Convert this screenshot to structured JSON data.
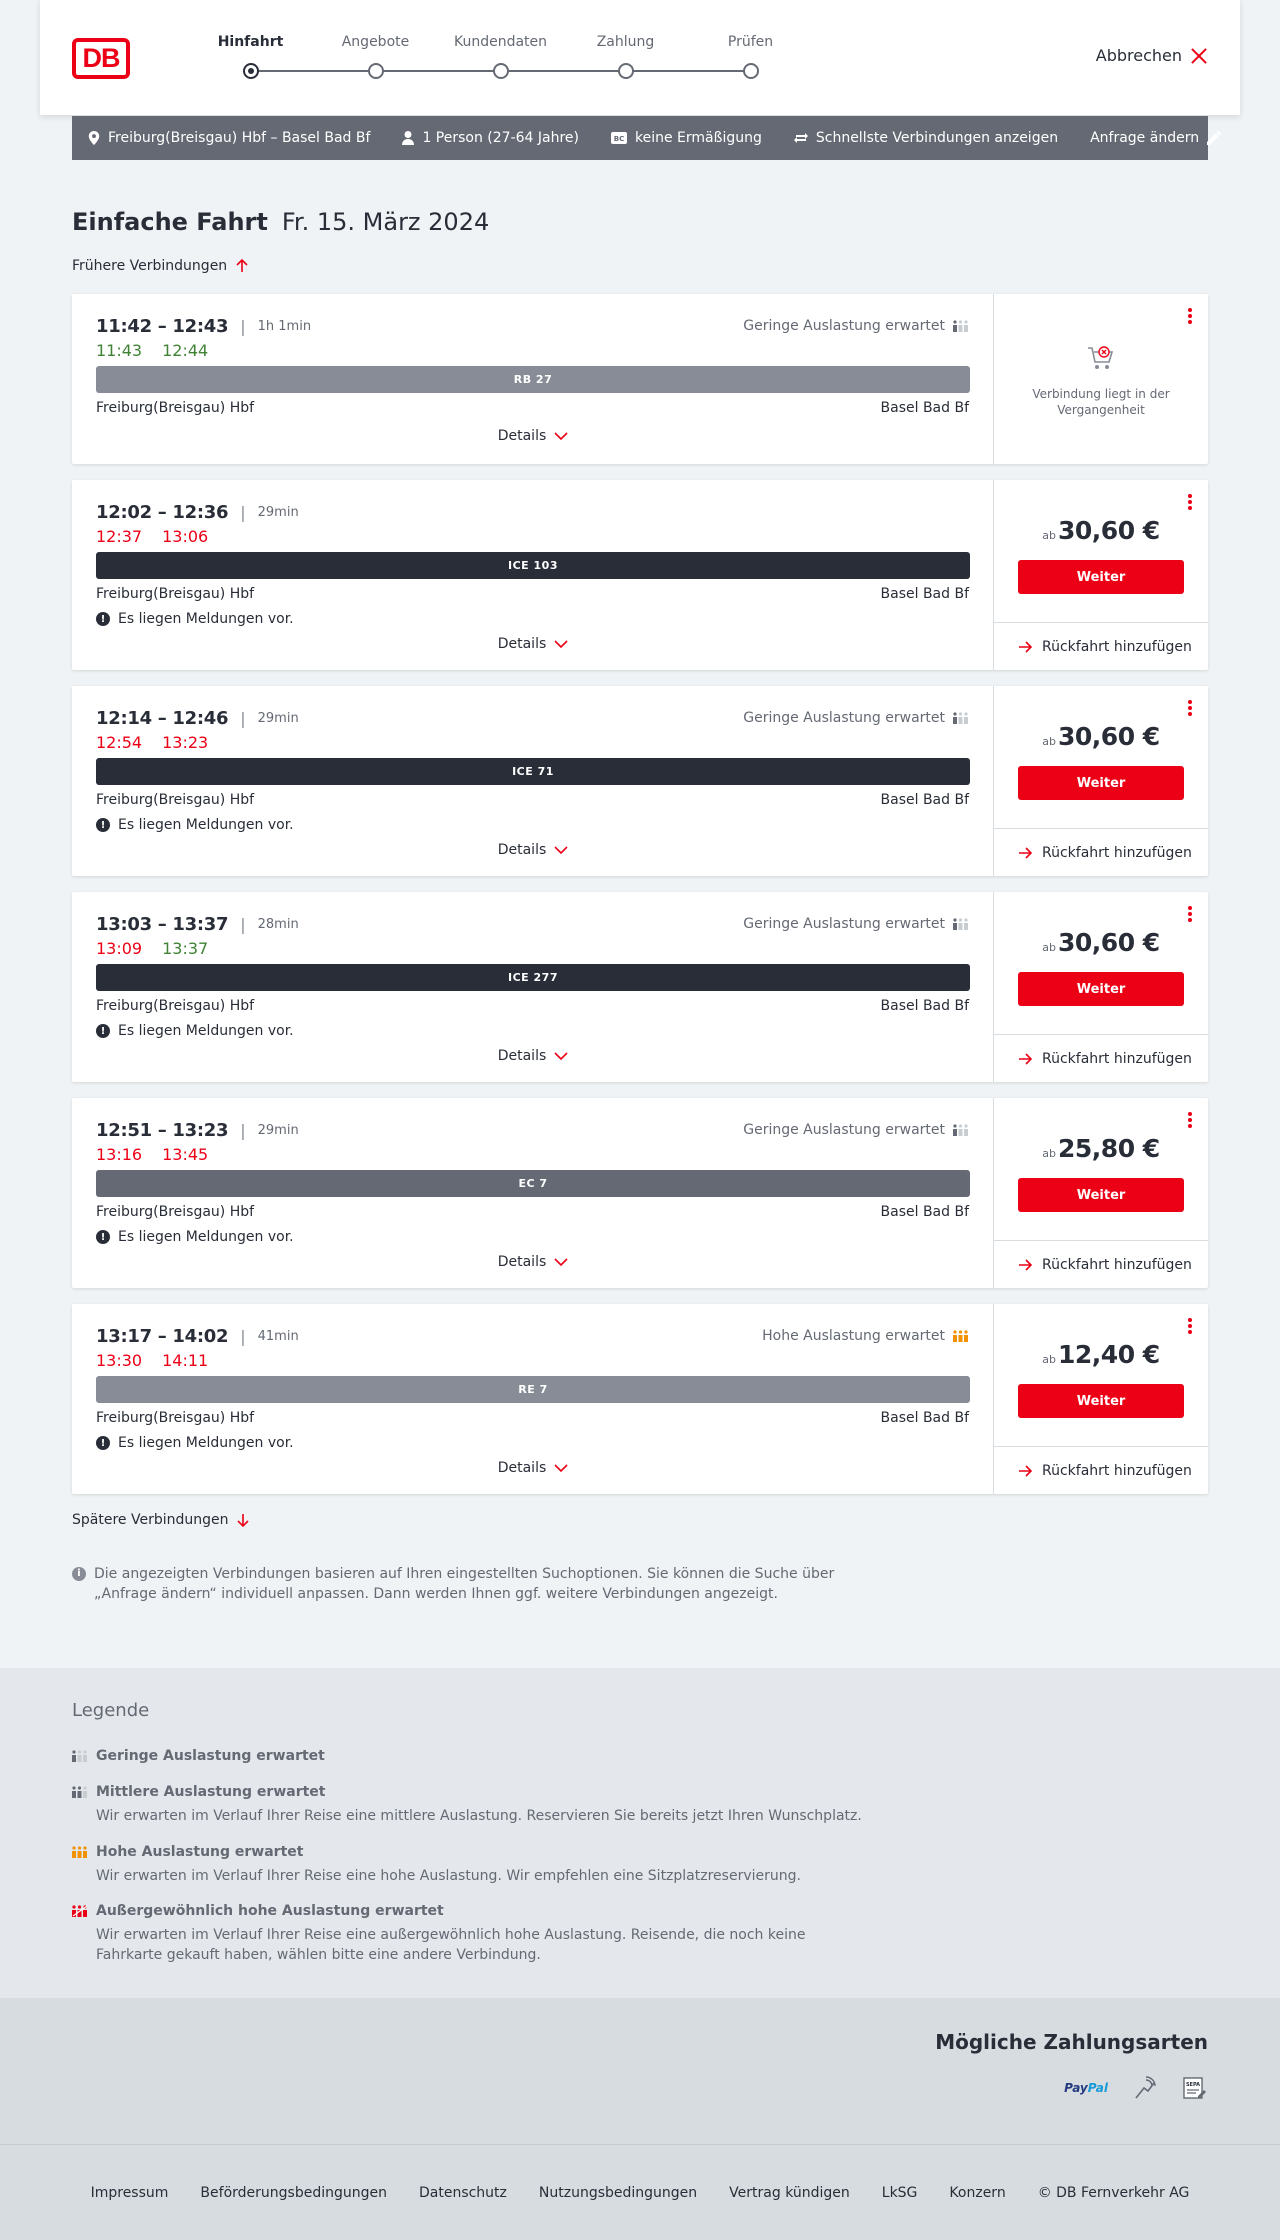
{
  "header": {
    "logo": "DB",
    "steps": [
      {
        "label": "Hinfahrt",
        "active": true
      },
      {
        "label": "Angebote",
        "active": false
      },
      {
        "label": "Kundendaten",
        "active": false
      },
      {
        "label": "Zahlung",
        "active": false
      },
      {
        "label": "Prüfen",
        "active": false
      }
    ],
    "cancel_label": "Abbrechen"
  },
  "search": {
    "route": "Freiburg(Breisgau) Hbf – Basel Bad Bf",
    "passengers": "1 Person (27-64 Jahre)",
    "discount": "keine Ermäßigung",
    "fastest": "Schnellste Verbindungen anzeigen",
    "change": "Anfrage ändern"
  },
  "title": {
    "main": "Einfache Fahrt",
    "date": "Fr. 15. März 2024"
  },
  "earlier_label": "Frühere Verbindungen",
  "later_label": "Spätere Verbindungen",
  "details_label": "Details",
  "notice_text": "Es liegen Meldungen vor.",
  "price_prefix": "ab",
  "continue_label": "Weiter",
  "return_label": "Rückfahrt hinzufügen",
  "past_label": "Verbindung liegt in der Vergangenheit",
  "connections": [
    {
      "times": "11:42 – 12:43",
      "duration": "1h 1min",
      "rt_dep": "11:43",
      "rt_dep_status": "ok",
      "rt_arr": "12:44",
      "rt_arr_status": "ok",
      "occupancy": "Geringe Auslastung erwartet",
      "occupancy_level": "low",
      "train": "RB 27",
      "train_type": "regio",
      "from": "Freiburg(Breisgau) Hbf",
      "to": "Basel Bad Bf",
      "notice": false,
      "price": null,
      "past": true
    },
    {
      "times": "12:02 – 12:36",
      "duration": "29min",
      "rt_dep": "12:37",
      "rt_dep_status": "late",
      "rt_arr": "13:06",
      "rt_arr_status": "late",
      "occupancy": "",
      "occupancy_level": "",
      "train": "ICE 103",
      "train_type": "ice",
      "from": "Freiburg(Breisgau) Hbf",
      "to": "Basel Bad Bf",
      "notice": true,
      "price": "30,60 €",
      "past": false
    },
    {
      "times": "12:14 – 12:46",
      "duration": "29min",
      "rt_dep": "12:54",
      "rt_dep_status": "late",
      "rt_arr": "13:23",
      "rt_arr_status": "late",
      "occupancy": "Geringe Auslastung erwartet",
      "occupancy_level": "low",
      "train": "ICE 71",
      "train_type": "ice",
      "from": "Freiburg(Breisgau) Hbf",
      "to": "Basel Bad Bf",
      "notice": true,
      "price": "30,60 €",
      "past": false
    },
    {
      "times": "13:03 – 13:37",
      "duration": "28min",
      "rt_dep": "13:09",
      "rt_dep_status": "late",
      "rt_arr": "13:37",
      "rt_arr_status": "ok",
      "occupancy": "Geringe Auslastung erwartet",
      "occupancy_level": "low",
      "train": "ICE 277",
      "train_type": "ice",
      "from": "Freiburg(Breisgau) Hbf",
      "to": "Basel Bad Bf",
      "notice": true,
      "price": "30,60 €",
      "past": false
    },
    {
      "times": "12:51 – 13:23",
      "duration": "29min",
      "rt_dep": "13:16",
      "rt_dep_status": "late",
      "rt_arr": "13:45",
      "rt_arr_status": "late",
      "occupancy": "Geringe Auslastung erwartet",
      "occupancy_level": "low",
      "train": "EC 7",
      "train_type": "ec",
      "from": "Freiburg(Breisgau) Hbf",
      "to": "Basel Bad Bf",
      "notice": true,
      "price": "25,80 €",
      "past": false
    },
    {
      "times": "13:17 – 14:02",
      "duration": "41min",
      "rt_dep": "13:30",
      "rt_dep_status": "late",
      "rt_arr": "14:11",
      "rt_arr_status": "late",
      "occupancy": "Hohe Auslastung erwartet",
      "occupancy_level": "high",
      "train": "RE 7",
      "train_type": "regio",
      "from": "Freiburg(Breisgau) Hbf",
      "to": "Basel Bad Bf",
      "notice": true,
      "price": "12,40 €",
      "past": false
    }
  ],
  "info_note": "Die angezeigten Verbindungen basieren auf Ihren eingestellten Suchoptionen. Sie können die Suche über „Anfrage ändern“ individuell anpassen. Dann werden Ihnen ggf. weitere Verbindungen angezeigt.",
  "legend": {
    "title": "Legende",
    "items": [
      {
        "level": "low",
        "head": "Geringe Auslastung erwartet",
        "desc": ""
      },
      {
        "level": "medium",
        "head": "Mittlere Auslastung erwartet",
        "desc": "Wir erwarten im Verlauf Ihrer Reise eine mittlere Auslastung. Reservieren Sie bereits jetzt Ihren Wunschplatz."
      },
      {
        "level": "high",
        "head": "Hohe Auslastung erwartet",
        "desc": "Wir erwarten im Verlauf Ihrer Reise eine hohe Auslastung. Wir empfehlen eine Sitzplatzreservierung."
      },
      {
        "level": "very-high",
        "head": "Außergewöhnlich hohe Auslastung erwartet",
        "desc": "Wir erwarten im Verlauf Ihrer Reise eine außergewöhnlich hohe Auslastung. Reisende, die noch keine Fahrkarte gekauft haben, wählen bitte eine andere Verbindung."
      }
    ]
  },
  "payment": {
    "title": "Mögliche Zahlungsarten",
    "paypal_a": "Pay",
    "paypal_b": "Pal",
    "sepa": "SEPA"
  },
  "footer_links": [
    "Impressum",
    "Beförderungsbedingungen",
    "Datenschutz",
    "Nutzungsbedingungen",
    "Vertrag kündigen",
    "LkSG",
    "Konzern",
    "© DB Fernverkehr AG"
  ],
  "colors": {
    "brand_red": "#ec0016",
    "on_time_green": "#408335",
    "high_occupancy_orange": "#f39200",
    "dark": "#282d37",
    "grey": "#646973"
  }
}
